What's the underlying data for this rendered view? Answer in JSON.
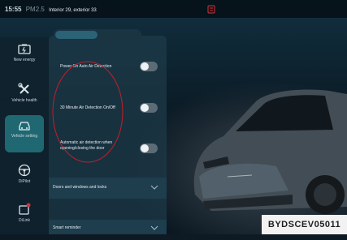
{
  "status": {
    "time": "15:55",
    "pm_label": "PM2.5",
    "temperature_text": "Interior  29, exterior 33"
  },
  "top_tabs": [
    "",
    ""
  ],
  "sidebar": {
    "items": [
      {
        "label": "New energy",
        "icon": "battery-icon"
      },
      {
        "label": "Vehicle health",
        "icon": "wrench-icon"
      },
      {
        "label": "Vehicle setting",
        "icon": "car-icon",
        "active": true
      },
      {
        "label": "DiPilot",
        "icon": "steering-wheel-icon"
      },
      {
        "label": "DiLink",
        "icon": "connect-icon"
      }
    ]
  },
  "settings": {
    "rows": [
      {
        "label": "Power On Auto Air Detection",
        "on": false
      },
      {
        "label": "30 Minute Air Detection On/Off",
        "on": false
      },
      {
        "label": "Automatic air detection when opening/closing the door",
        "on": false
      }
    ],
    "expandables": [
      {
        "label": "Doors and windows and locks"
      },
      {
        "label": "Smart reminder"
      }
    ]
  },
  "colors": {
    "accent": "#1f6872",
    "annotation": "#c0202a",
    "toggle_off": "#5c6c76"
  },
  "watermark": "BYDSCEV05011"
}
